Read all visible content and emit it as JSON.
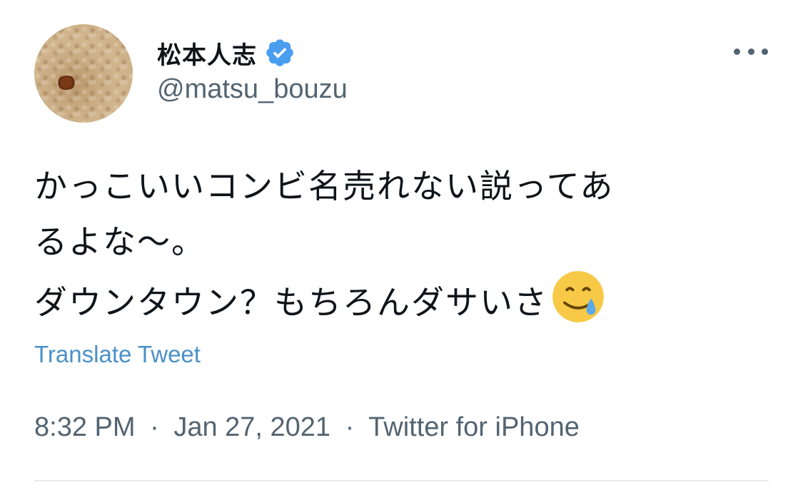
{
  "user": {
    "display_name": "松本人志",
    "handle": "@matsu_bouzu",
    "verified_badge_icon": "verified-badge-icon",
    "verified_color": "#4a9ef0"
  },
  "tweet": {
    "lines": [
      "かっこいいコンビ名売れない説ってあ",
      "るよな〜。",
      "ダウンタウン？もちろんダサいさ"
    ],
    "emoji": "smiling-face-with-tear-icon",
    "translate_label": "Translate Tweet"
  },
  "meta": {
    "time": "8:32 PM",
    "separator": "·",
    "date": "Jan 27, 2021",
    "source": "Twitter for iPhone"
  },
  "colors": {
    "link": "#4a90c8",
    "secondary_text": "#536471",
    "primary_text": "#0f1419"
  }
}
